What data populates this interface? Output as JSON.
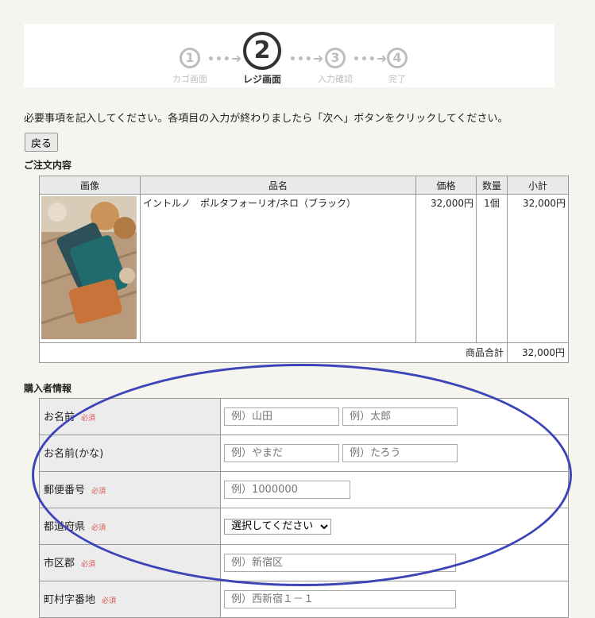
{
  "steps": [
    {
      "num": "1",
      "label": "カゴ画面"
    },
    {
      "num": "2",
      "label": "レジ画面"
    },
    {
      "num": "3",
      "label": "入力確認"
    },
    {
      "num": "4",
      "label": "完了"
    }
  ],
  "intro_text": "必要事項を記入してください。各項目の入力が終わりましたら「次へ」ボタンをクリックしてください。",
  "back_button": "戻る",
  "order_section_title": "ご注文内容",
  "order_table": {
    "headers": {
      "image": "画像",
      "name": "品名",
      "price": "価格",
      "qty": "数量",
      "subtotal": "小計"
    },
    "rows": [
      {
        "name": "イントルノ　ポルタフォーリオ/ネロ（ブラック）",
        "price": "32,000円",
        "qty": "1個",
        "subtotal": "32,000円"
      }
    ],
    "total_label": "商品合計",
    "total_value": "32,000円"
  },
  "buyer_section_title": "購入者情報",
  "buyer_form": {
    "required_label": "必須",
    "name_label": "お名前",
    "name_last_placeholder": "例）山田",
    "name_first_placeholder": "例）太郎",
    "kana_label": "お名前(かな)",
    "kana_last_placeholder": "例）やまだ",
    "kana_first_placeholder": "例）たろう",
    "zip_label": "郵便番号",
    "zip_placeholder": "例）1000000",
    "pref_label": "都道府県",
    "pref_selected": "選択してください",
    "city_label": "市区郡",
    "city_placeholder": "例）新宿区",
    "town_label": "町村字番地",
    "town_placeholder": "例）西新宿１－１"
  },
  "colors": {
    "annotation_ellipse": "#3d44b8",
    "required": "#d9534f",
    "header_bg": "#e9e9e9"
  }
}
